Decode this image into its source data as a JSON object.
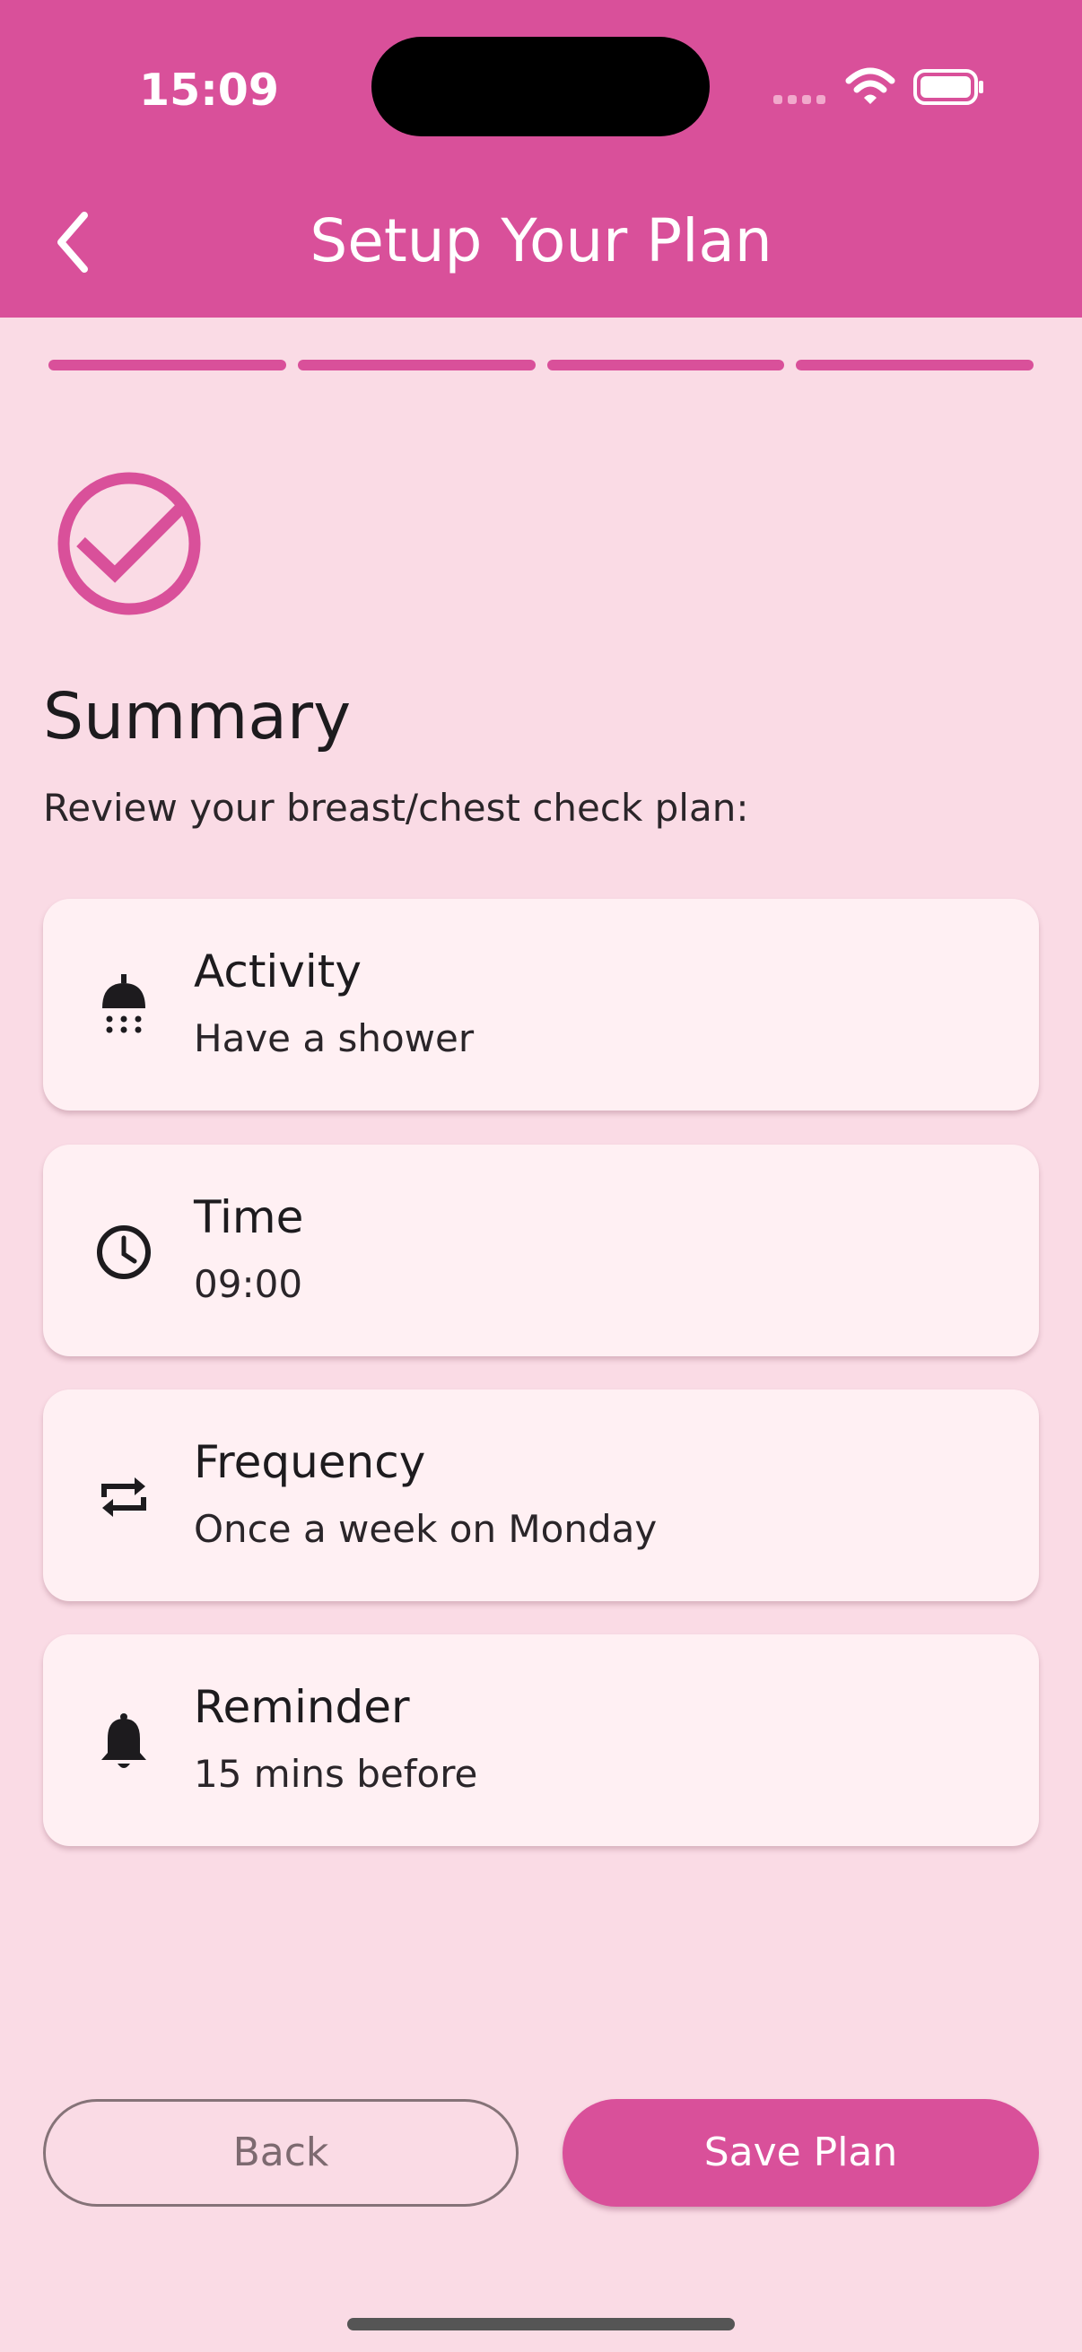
{
  "status_bar": {
    "time": "15:09"
  },
  "appbar": {
    "title": "Setup Your Plan"
  },
  "progress": {
    "steps_total": 4,
    "steps_complete": 4
  },
  "summary": {
    "title": "Summary",
    "subtitle": "Review your breast/chest check plan:"
  },
  "cards": [
    {
      "title": "Activity",
      "value": "Have a shower",
      "icon": "shower-icon"
    },
    {
      "title": "Time",
      "value": "09:00",
      "icon": "clock-icon"
    },
    {
      "title": "Frequency",
      "value": "Once a week on Monday",
      "icon": "repeat-icon"
    },
    {
      "title": "Reminder",
      "value": "15 mins before",
      "icon": "bell-icon"
    }
  ],
  "buttons": {
    "back": "Back",
    "save": "Save Plan"
  },
  "colors": {
    "accent": "#d9509a",
    "background": "#fadbe5",
    "card": "#fff0f3"
  }
}
